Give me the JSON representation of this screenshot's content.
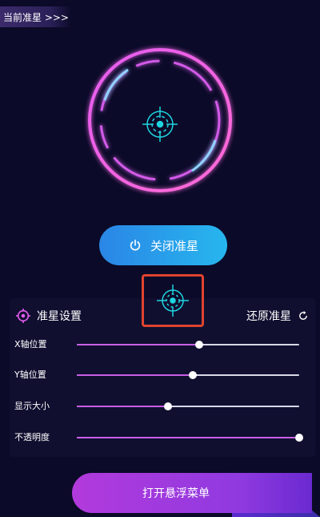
{
  "header": {
    "current_tag": "当前准星 >>>"
  },
  "main": {
    "toggle_label": "关闭准星",
    "settings_title": "准星设置",
    "restore_label": "还原准星"
  },
  "sliders": [
    {
      "label": "X轴位置",
      "value": 0.55
    },
    {
      "label": "Y轴位置",
      "value": 0.52
    },
    {
      "label": "显示大小",
      "value": 0.41
    },
    {
      "label": "不透明度",
      "value": 1.0
    }
  ],
  "footer": {
    "menu_label": "打开悬浮菜单"
  },
  "colors": {
    "accent_pink": "#e45cf0",
    "accent_blue": "#27b6ee",
    "slider_fill": "#c95fe6",
    "crosshair": "#1fd4e0",
    "preview_border": "#e0432e"
  },
  "icons": {
    "power": "power-icon",
    "crosshair": "crosshair-icon",
    "target": "target-icon",
    "refresh": "refresh-icon"
  }
}
